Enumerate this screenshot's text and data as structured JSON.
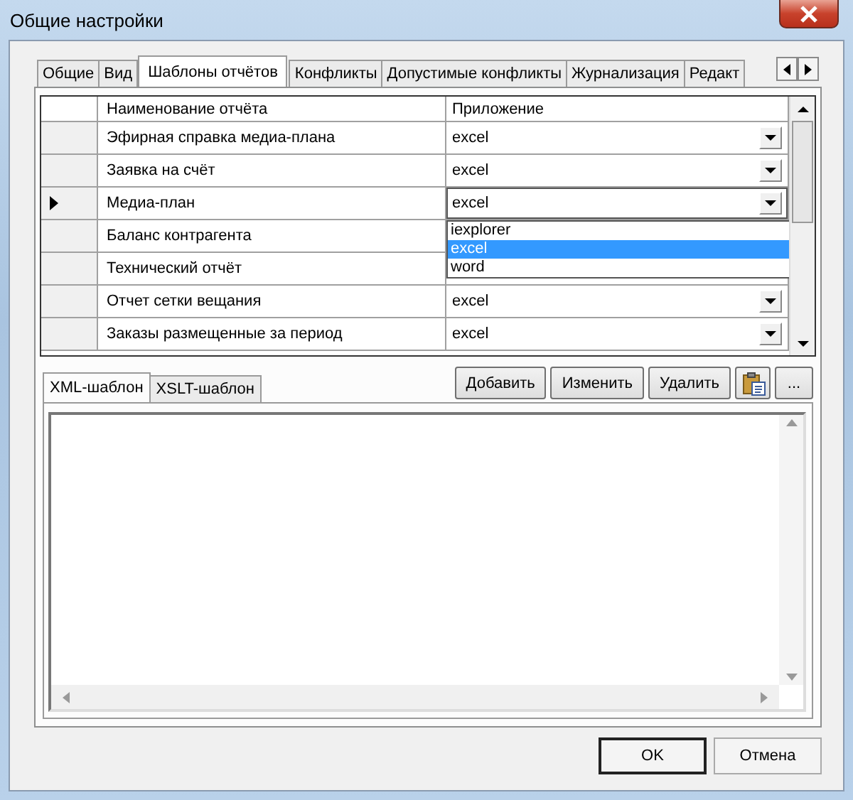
{
  "window": {
    "title": "Общие настройки"
  },
  "tabs": [
    {
      "label": "Общие",
      "selected": false
    },
    {
      "label": "Вид",
      "selected": false
    },
    {
      "label": "Шаблоны отчётов",
      "selected": true
    },
    {
      "label": "Конфликты",
      "selected": false
    },
    {
      "label": "Допустимые конфликты",
      "selected": false
    },
    {
      "label": "Журнализация",
      "selected": false
    },
    {
      "label": "Редакт",
      "selected": false
    }
  ],
  "grid": {
    "columns": [
      "Наименование отчёта",
      "Приложение"
    ],
    "rows": [
      {
        "name": "Эфирная справка медиа-плана",
        "app": "excel",
        "current": false
      },
      {
        "name": "Заявка на счёт",
        "app": "excel",
        "current": false
      },
      {
        "name": "Медиа-план",
        "app": "excel",
        "current": true
      },
      {
        "name": "Баланс контрагента",
        "current": false
      },
      {
        "name": "Технический отчёт",
        "current": false
      },
      {
        "name": "Отчет сетки вещания",
        "app": "excel",
        "current": false
      },
      {
        "name": "Заказы размещенные за период",
        "app": "excel",
        "current": false
      }
    ],
    "dropdown": {
      "options": [
        {
          "label": "iexplorer",
          "selected": false
        },
        {
          "label": "excel",
          "selected": true
        },
        {
          "label": "word",
          "selected": false
        }
      ]
    }
  },
  "template_tabs": [
    {
      "label": "XML-шаблон",
      "selected": true
    },
    {
      "label": "XSLT-шаблон",
      "selected": false
    }
  ],
  "template_buttons": [
    "Добавить",
    "Изменить",
    "Удалить"
  ],
  "more_button": "...",
  "footer_buttons": [
    {
      "label": "OK",
      "default": true
    },
    {
      "label": "Отмена",
      "default": false
    }
  ]
}
